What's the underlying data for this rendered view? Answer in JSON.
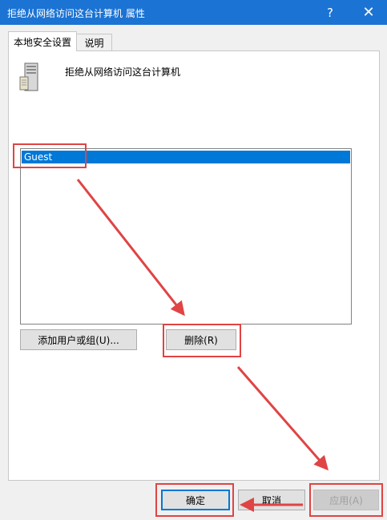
{
  "window": {
    "title": "拒绝从网络访问这台计算机 属性",
    "help_label": "?",
    "close_label": "✕"
  },
  "tabs": [
    {
      "label": "本地安全设置",
      "active": true
    },
    {
      "label": "说明",
      "active": false
    }
  ],
  "policy": {
    "name": "拒绝从网络访问这台计算机",
    "icon": "server-icon"
  },
  "accounts": {
    "items": [
      "Guest"
    ],
    "selected": "Guest"
  },
  "buttons": {
    "add": "添加用户或组(U)...",
    "remove": "删除(R)",
    "ok": "确定",
    "cancel": "取消",
    "apply": "应用(A)"
  },
  "colors": {
    "titlebar": "#1b73d3",
    "selection": "#0078d7",
    "annotation": "#e04444"
  }
}
